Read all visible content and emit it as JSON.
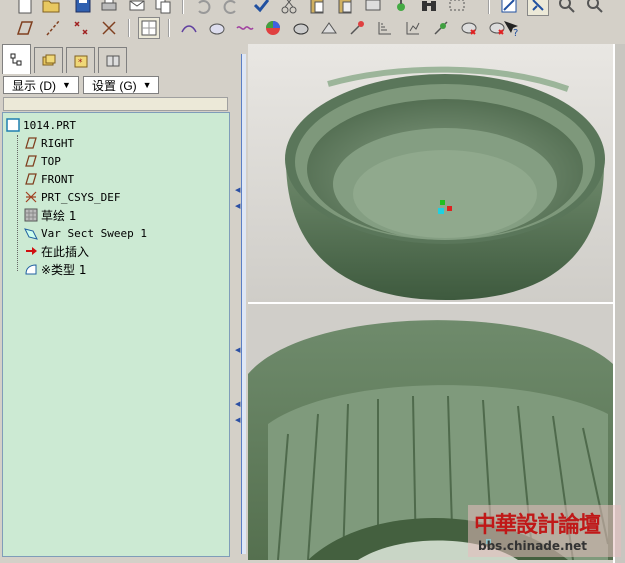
{
  "toolbar": {
    "row1": [
      "new-icon",
      "open-icon",
      "save-icon",
      "print-icon",
      "email-icon",
      "copy-icon",
      "undo-icon",
      "redo-icon",
      "regenerate-icon",
      "cut-icon",
      "paste-icon",
      "paste-special-icon",
      "layer-icon",
      "light-icon",
      "binoculars-icon",
      "select-box-icon",
      "sketch-icon",
      "select-icon",
      "zoom-in-icon",
      "zoom-out-icon"
    ],
    "row2": [
      "datum-plane-icon",
      "datum-axis-icon",
      "datum-point-icon",
      "csys-icon",
      "view-manager-icon",
      "wireframe-icon",
      "hidden-line-icon",
      "no-hidden-icon",
      "shading-icon",
      "saved-views-icon",
      "orient-icon",
      "repaint-icon",
      "spin-center-icon",
      "plane-display-icon",
      "axis-display-icon",
      "point-display-icon",
      "csys-display-icon",
      "whats-this-icon"
    ]
  },
  "tabs": [
    "model-tree-tab",
    "folder-browser-tab",
    "favorites-tab",
    "connections-tab"
  ],
  "menus": {
    "show_label": "显示 (D)",
    "settings_label": "设置 (G)"
  },
  "tree": {
    "root": "1014.PRT",
    "items": [
      {
        "label": "RIGHT",
        "icon": "datum-plane-icon"
      },
      {
        "label": "TOP",
        "icon": "datum-plane-icon"
      },
      {
        "label": "FRONT",
        "icon": "datum-plane-icon"
      },
      {
        "label": "PRT_CSYS_DEF",
        "icon": "csys-icon"
      },
      {
        "label": "草绘 1",
        "icon": "sketch-icon"
      },
      {
        "label": "Var Sect Sweep 1",
        "icon": "sweep-icon"
      },
      {
        "label": "在此插入",
        "icon": "insert-arrow-icon"
      },
      {
        "label": "※类型 1",
        "icon": "feature-icon"
      }
    ]
  },
  "colors": {
    "model_green": "#5f7a5e",
    "tree_bg": "#ccead3",
    "watermark_red": "#c01818"
  },
  "watermark": {
    "title": "中華設計論壇",
    "url": "bbs.chinade.net"
  }
}
